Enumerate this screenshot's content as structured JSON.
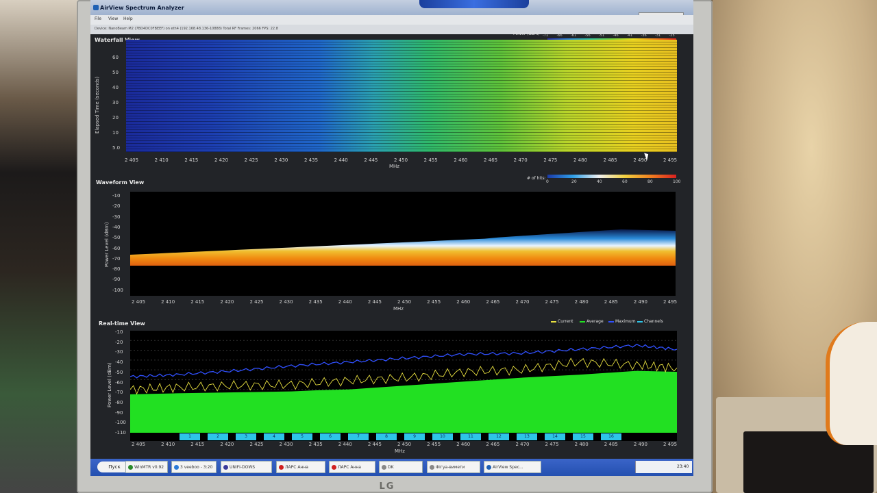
{
  "window": {
    "title": "AirView Spectrum Analyzer",
    "reset_label": "Reset All Data"
  },
  "menu": [
    "File",
    "View",
    "Help"
  ],
  "device_info": "Device: NanoBeam M2 (7BD4DC0FBEEF) on eth4 (192.168.48.136-10888)   Total RF Frames: 2066   FPS: 22.8",
  "waterfall": {
    "title": "Waterfall View",
    "colorbar_title": "Power (dBm)",
    "colorbar_ticks": [
      "-71",
      "-66",
      "-61",
      "-56",
      "-51",
      "-46",
      "-41",
      "-36",
      "-31",
      "-25"
    ],
    "ylabel": "Elapsed Time (seconds)",
    "yticks": [
      "60",
      "50",
      "40",
      "30",
      "20",
      "10",
      "5.0"
    ],
    "xlabel": "MHz"
  },
  "waveform": {
    "title": "Waveform View",
    "colorbar_title": "# of hits:",
    "colorbar_ticks": [
      "0",
      "20",
      "40",
      "60",
      "80",
      "100"
    ],
    "ylabel": "Power Level (dBm)",
    "yticks": [
      "-10",
      "-20",
      "-30",
      "-40",
      "-50",
      "-60",
      "-70",
      "-80",
      "-90",
      "-100"
    ],
    "xlabel": "MHz"
  },
  "realtime": {
    "title": "Real-time View",
    "ylabel": "Power Level (dBm)",
    "yticks": [
      "-10",
      "-20",
      "-30",
      "-40",
      "-50",
      "-60",
      "-70",
      "-80",
      "-90",
      "-100",
      "-110"
    ],
    "xlabel": "MHz",
    "legend": [
      {
        "label": "Current",
        "color": "#e8e040"
      },
      {
        "label": "Average",
        "color": "#22e022"
      },
      {
        "label": "Maximum",
        "color": "#3050ff"
      },
      {
        "label": "Channels",
        "color": "#2ec4e8"
      }
    ],
    "channels": [
      "1",
      "2",
      "3",
      "4",
      "5",
      "6",
      "7",
      "8",
      "9",
      "10",
      "11",
      "12",
      "13",
      "14",
      "15",
      "16"
    ]
  },
  "freq_ticks": [
    "2 405",
    "2 410",
    "2 415",
    "2 420",
    "2 425",
    "2 430",
    "2 435",
    "2 440",
    "2 445",
    "2 450",
    "2 455",
    "2 460",
    "2 465",
    "2 470",
    "2 475",
    "2 480",
    "2 485",
    "2 490",
    "2 495"
  ],
  "taskbar": {
    "start": "Пуск",
    "buttons": [
      "WinMTR v0.92",
      "3 veeboo - 3:20",
      "UNIFI-DOWS",
      "ЛАРС Анна",
      "ЛАРС Анна",
      "DK",
      "Фігуа-вимети",
      "AirView Spec..."
    ],
    "clock": "23:40"
  },
  "chart_data": [
    {
      "type": "line",
      "title": "Real-time View",
      "xlabel": "MHz",
      "ylabel": "Power Level (dBm)",
      "xlim": [
        2402,
        2497
      ],
      "ylim": [
        -115,
        -10
      ],
      "series": [
        {
          "name": "Maximum",
          "x": [
            2402,
            2410,
            2420,
            2430,
            2440,
            2450,
            2460,
            2470,
            2480,
            2490,
            2497
          ],
          "values": [
            -57,
            -55,
            -51,
            -46,
            -42,
            -38,
            -34,
            -33,
            -29,
            -25,
            -29
          ]
        },
        {
          "name": "Current",
          "x": [
            2402,
            2410,
            2420,
            2430,
            2440,
            2450,
            2460,
            2470,
            2480,
            2490,
            2497
          ],
          "values": [
            -70,
            -68,
            -66,
            -65,
            -61,
            -58,
            -52,
            -50,
            -42,
            -45,
            -48
          ]
        },
        {
          "name": "Average",
          "x": [
            2402,
            2410,
            2420,
            2430,
            2434,
            2440,
            2450,
            2460,
            2470,
            2480,
            2490,
            2497
          ],
          "values": [
            -75,
            -74,
            -73,
            -72,
            -71,
            -70,
            -66,
            -62,
            -58,
            -55,
            -51,
            -52
          ]
        }
      ]
    }
  ]
}
